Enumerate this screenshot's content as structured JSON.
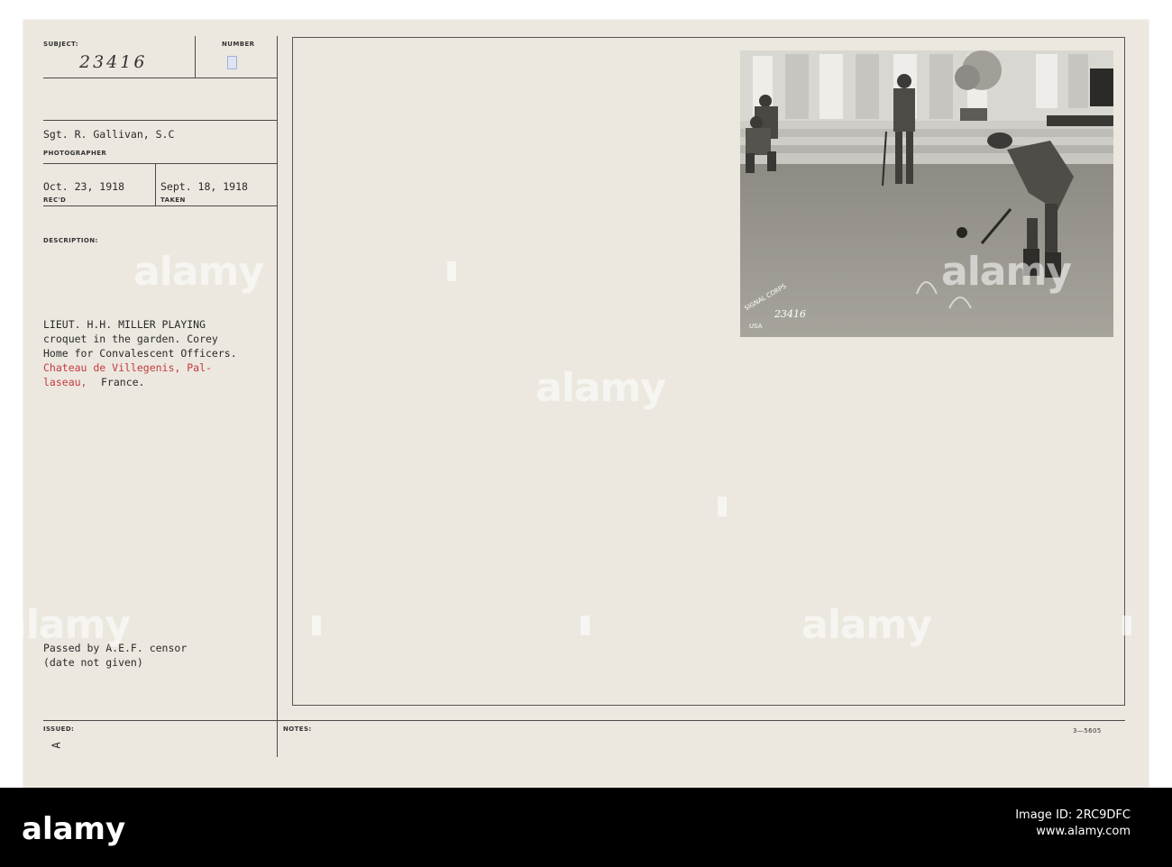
{
  "card": {
    "labels": {
      "subject": "SUBJECT:",
      "number": "NUMBER",
      "photographer": "PHOTOGRAPHER",
      "recd": "REC'D",
      "taken": "TAKEN",
      "description": "DESCRIPTION:",
      "issued": "ISSUED:",
      "notes": "NOTES:"
    },
    "subject_number": "23416",
    "photographer_name": "Sgt. R. Gallivan, S.C",
    "received_date": "Oct. 23, 1918",
    "taken_date": "Sept. 18, 1918",
    "description_lines": [
      "LIEUT. H.H. MILLER PLAYING",
      "croquet in the garden. Corey",
      "Home for Convalescent Officers."
    ],
    "description_red_lines": [
      "Chateau de Villegenis, Pal-",
      "laseau,"
    ],
    "description_tail": "France.",
    "censor_lines": [
      "Passed by A.E.F. censor",
      "(date not given)"
    ],
    "issued_mark": "A",
    "form_code": "3—5605",
    "photo_stamp_number": "23416",
    "photo_stamp_text": "SIGNAL CORPS",
    "photo_stamp_usa": "USA"
  },
  "watermark": {
    "text": "alamy",
    "color": "#ffffff"
  },
  "footer": {
    "brand": "alamy",
    "image_id_label": "Image ID: 2RC9DFC",
    "url": "www.alamy.com"
  }
}
